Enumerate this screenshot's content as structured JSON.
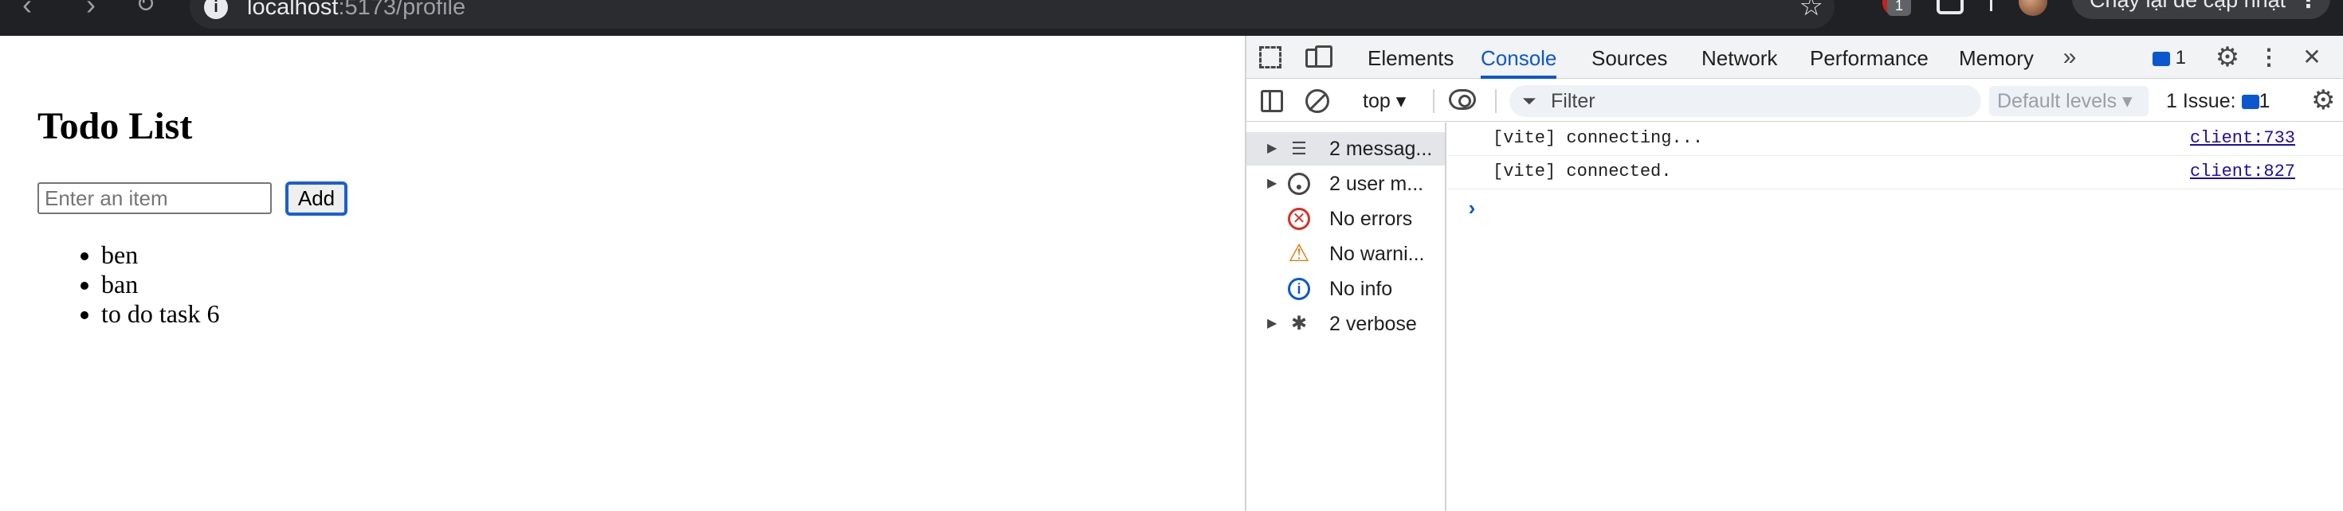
{
  "browser": {
    "url_host": "localhost",
    "url_path": ":5173/profile",
    "ext_badge": "1",
    "update_button": "Chạy lại để cập nhật"
  },
  "page": {
    "title": "Todo List",
    "input_placeholder": "Enter an item",
    "add_label": "Add",
    "items": [
      "ben",
      "ban",
      "to do task 6"
    ]
  },
  "devtools": {
    "tabs": [
      "Elements",
      "Console",
      "Sources",
      "Network",
      "Performance",
      "Memory"
    ],
    "active_tab": "Console",
    "message_count": "1",
    "context": "top",
    "filter_placeholder": "Filter",
    "levels": "Default levels",
    "issues_label": "1 Issue:",
    "issues_count": "1",
    "sidebar": [
      {
        "label": "2 messag...",
        "icon": "list-icon"
      },
      {
        "label": "2 user m...",
        "icon": "user-icon"
      },
      {
        "label": "No errors",
        "icon": "error-icon"
      },
      {
        "label": "No warni...",
        "icon": "warning-icon"
      },
      {
        "label": "No info",
        "icon": "info-icon"
      },
      {
        "label": "2 verbose",
        "icon": "bug-icon"
      }
    ],
    "logs": [
      {
        "message": "[vite] connecting...",
        "source": "client:733"
      },
      {
        "message": "[vite] connected.",
        "source": "client:827"
      }
    ]
  },
  "colors": {
    "accent": "#0b57d0",
    "error": "#d93025",
    "warning": "#e37400"
  }
}
